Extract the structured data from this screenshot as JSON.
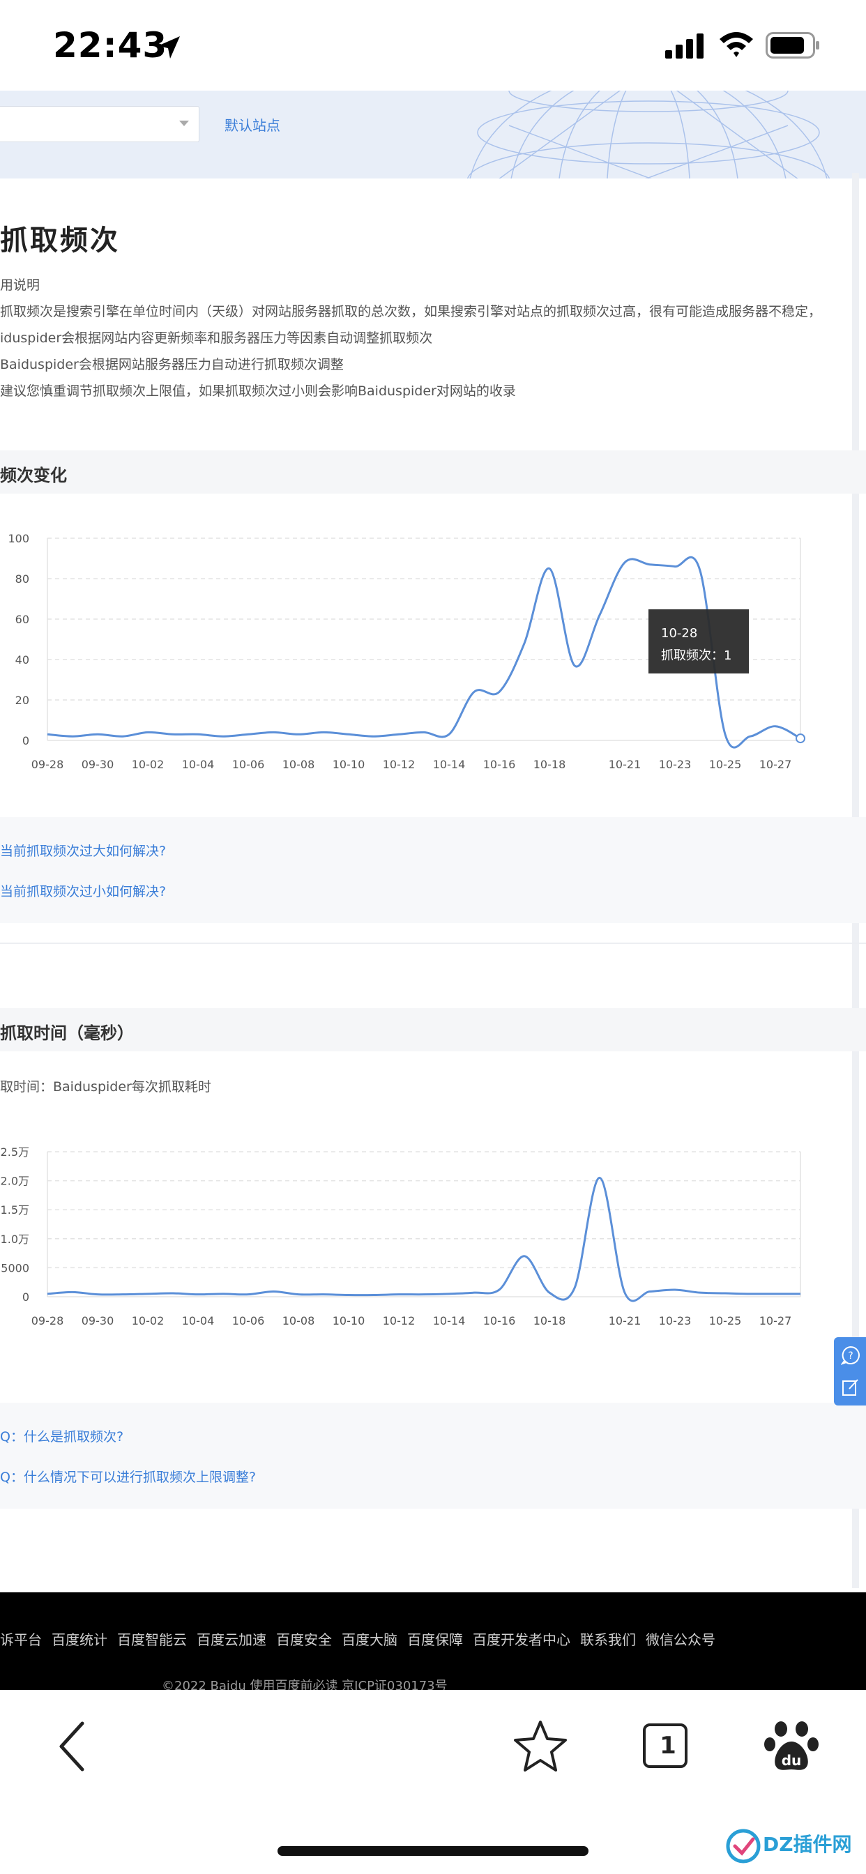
{
  "status_bar": {
    "time": "22:43"
  },
  "header": {
    "default_site": "默认站点"
  },
  "page": {
    "title": "抓取频次",
    "usage_label": "用说明",
    "description": [
      "抓取频次是搜索引擎在单位时间内（天级）对网站服务器抓取的总次数，如果搜索引擎对站点的抓取频次过高，很有可能造成服务器不稳定，",
      "iduspider会根据网站内容更新频率和服务器压力等因素自动调整抓取频次",
      "Baiduspider会根据网站服务器压力自动进行抓取频次调整",
      "建议您慎重调节抓取频次上限值，如果抓取频次过小则会影响Baiduspider对网站的收录"
    ]
  },
  "section1": {
    "title": "频次变化"
  },
  "tooltip": {
    "date": "10-28",
    "label": "抓取频次：1"
  },
  "faq1": [
    "当前抓取频次过大如何解决?",
    "当前抓取频次过小如何解决?"
  ],
  "section2": {
    "title": "抓取时间（毫秒）",
    "desc": "取时间：Baiduspider每次抓取耗时"
  },
  "faq2": [
    "Q：什么是抓取频次?",
    "Q：什么情况下可以进行抓取频次上限调整?"
  ],
  "footer": {
    "links": [
      "诉平台",
      "百度统计",
      "百度智能云",
      "百度云加速",
      "百度安全",
      "百度大脑",
      "百度保障",
      "百度开发者中心",
      "联系我们",
      "微信公众号"
    ],
    "copyright": "©2022 Baidu 使用百度前必读 京ICP证030173号"
  },
  "toolbar": {
    "tab_count": "1"
  },
  "watermark": {
    "text": "DZ插件网"
  },
  "chart_data": [
    {
      "type": "line",
      "x_ticks": [
        "09-28",
        "09-30",
        "10-02",
        "10-04",
        "10-06",
        "10-08",
        "10-10",
        "10-12",
        "10-14",
        "10-16",
        "10-18",
        "10-21",
        "10-23",
        "10-25",
        "10-27"
      ],
      "x": [
        "09-28",
        "09-29",
        "09-30",
        "10-01",
        "10-02",
        "10-03",
        "10-04",
        "10-05",
        "10-06",
        "10-07",
        "10-08",
        "10-09",
        "10-10",
        "10-11",
        "10-12",
        "10-13",
        "10-14",
        "10-15",
        "10-16",
        "10-17",
        "10-18",
        "10-19",
        "10-20",
        "10-21",
        "10-22",
        "10-23",
        "10-24",
        "10-25",
        "10-26",
        "10-27",
        "10-28"
      ],
      "series": [
        {
          "values": [
            3,
            2,
            3,
            2,
            4,
            3,
            3,
            2,
            3,
            4,
            3,
            4,
            3,
            2,
            3,
            4,
            3,
            24,
            24,
            48,
            85,
            37,
            62,
            88,
            87,
            86,
            84,
            3,
            2,
            7,
            1
          ]
        }
      ],
      "y_ticks": [
        "0",
        "20",
        "40",
        "60",
        "80",
        "100"
      ],
      "ylim": [
        0,
        100
      ],
      "grid": true,
      "color": "#5b8fd8"
    },
    {
      "type": "line",
      "x_ticks": [
        "09-28",
        "09-30",
        "10-02",
        "10-04",
        "10-06",
        "10-08",
        "10-10",
        "10-12",
        "10-14",
        "10-16",
        "10-18",
        "10-21",
        "10-23",
        "10-25",
        "10-27"
      ],
      "x": [
        "09-28",
        "09-29",
        "09-30",
        "10-01",
        "10-02",
        "10-03",
        "10-04",
        "10-05",
        "10-06",
        "10-07",
        "10-08",
        "10-09",
        "10-10",
        "10-11",
        "10-12",
        "10-13",
        "10-14",
        "10-15",
        "10-16",
        "10-17",
        "10-18",
        "10-19",
        "10-20",
        "10-21",
        "10-22",
        "10-23",
        "10-24",
        "10-25",
        "10-26",
        "10-27",
        "10-28"
      ],
      "series": [
        {
          "values": [
            500,
            800,
            400,
            400,
            500,
            600,
            400,
            500,
            400,
            900,
            400,
            400,
            300,
            300,
            400,
            400,
            500,
            700,
            1200,
            7000,
            700,
            1500,
            20500,
            700,
            900,
            1200,
            700,
            600,
            500,
            500,
            500
          ]
        }
      ],
      "y_ticks": [
        "0",
        "5000",
        "1.0万",
        "1.5万",
        "2.0万",
        "2.5万"
      ],
      "ylim": [
        0,
        25000
      ],
      "grid": true,
      "color": "#5b8fd8"
    }
  ]
}
